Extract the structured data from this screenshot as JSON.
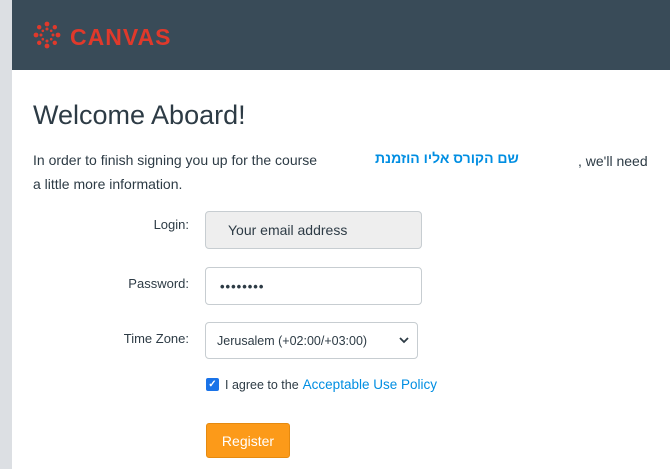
{
  "app": {
    "logo_text": "CANVAS",
    "brand_color": "#e0392b",
    "header_color": "#394b58"
  },
  "page": {
    "title": "Welcome Aboard!",
    "intro_prefix": "In order to finish signing you up for the course",
    "course_name": "שם הקורס אליו הוזמנת",
    "intro_suffix": ", we'll need",
    "intro_line2": "a little more information."
  },
  "form": {
    "login_label": "Login:",
    "login_value": "Your email address",
    "password_label": "Password:",
    "password_value": "••••••••",
    "timezone_label": "Time Zone:",
    "timezone_value": "Jerusalem (+02:00/+03:00)",
    "agree_checked": true,
    "agree_text": "I agree to the",
    "policy_link": "Acceptable Use Policy",
    "register_label": "Register"
  },
  "icons": {
    "logo": "canvas-logo-icon",
    "select": "chevron-down-icon",
    "check": "checkmark-icon"
  },
  "colors": {
    "link": "#008ee2",
    "register_button": "#fc9a19",
    "checkbox": "#1a73e8"
  }
}
